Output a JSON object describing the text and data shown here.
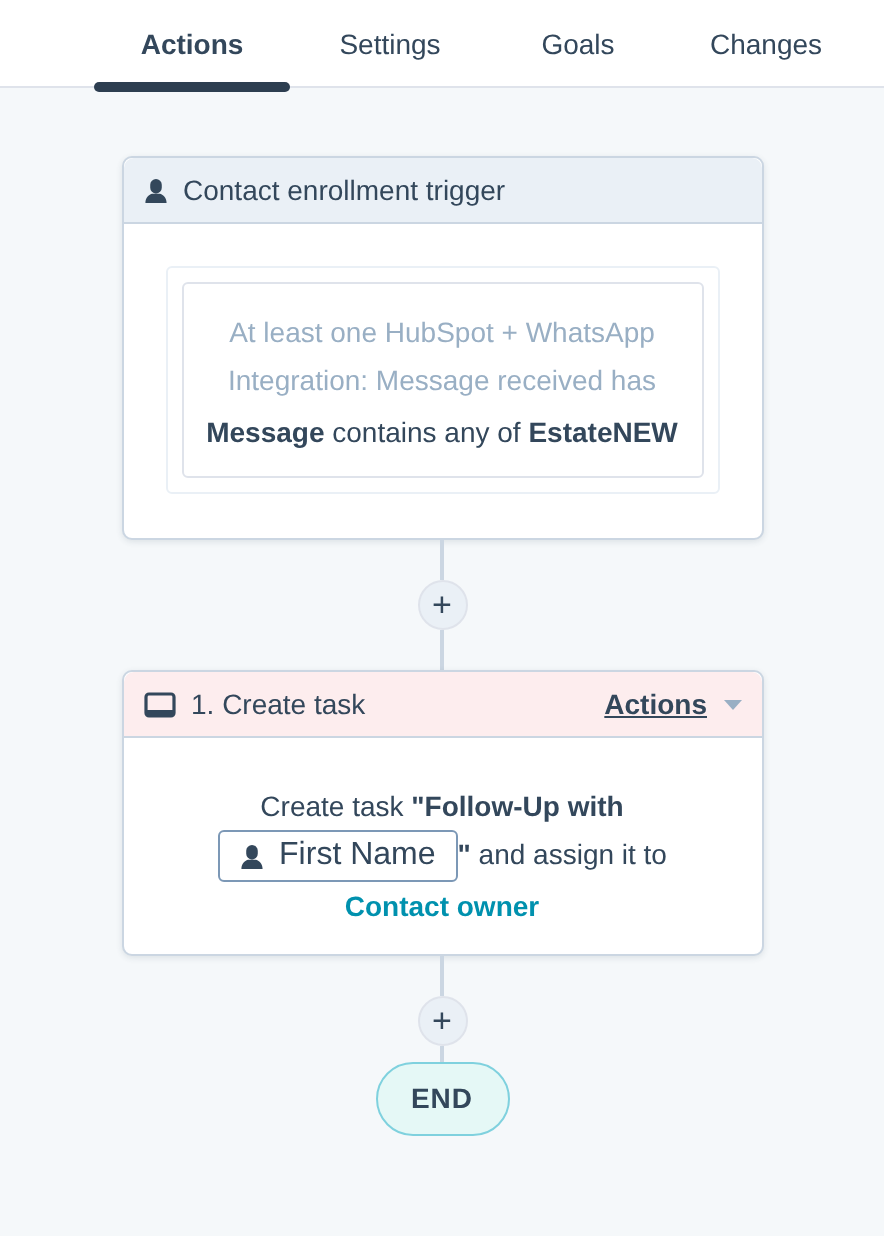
{
  "tabs": [
    {
      "label": "Actions",
      "selected": true
    },
    {
      "label": "Settings",
      "selected": false
    },
    {
      "label": "Goals",
      "selected": false
    },
    {
      "label": "Changes",
      "selected": false
    }
  ],
  "trigger": {
    "title": "Contact enrollment trigger",
    "filter_intro": "At least one HubSpot + WhatsApp Integration: Message received has",
    "filter_rule": "**Message** contains any of **EstateNEW**"
  },
  "add_buttons": [
    "+",
    "+"
  ],
  "action": {
    "title": "1. Create task",
    "menu": "Actions",
    "prefix": "Create task **\"Follow-Up with**",
    "token": "First Name",
    "suffix": "**\"** and assign it to",
    "owner_link": "Contact owner"
  },
  "end": "END"
}
